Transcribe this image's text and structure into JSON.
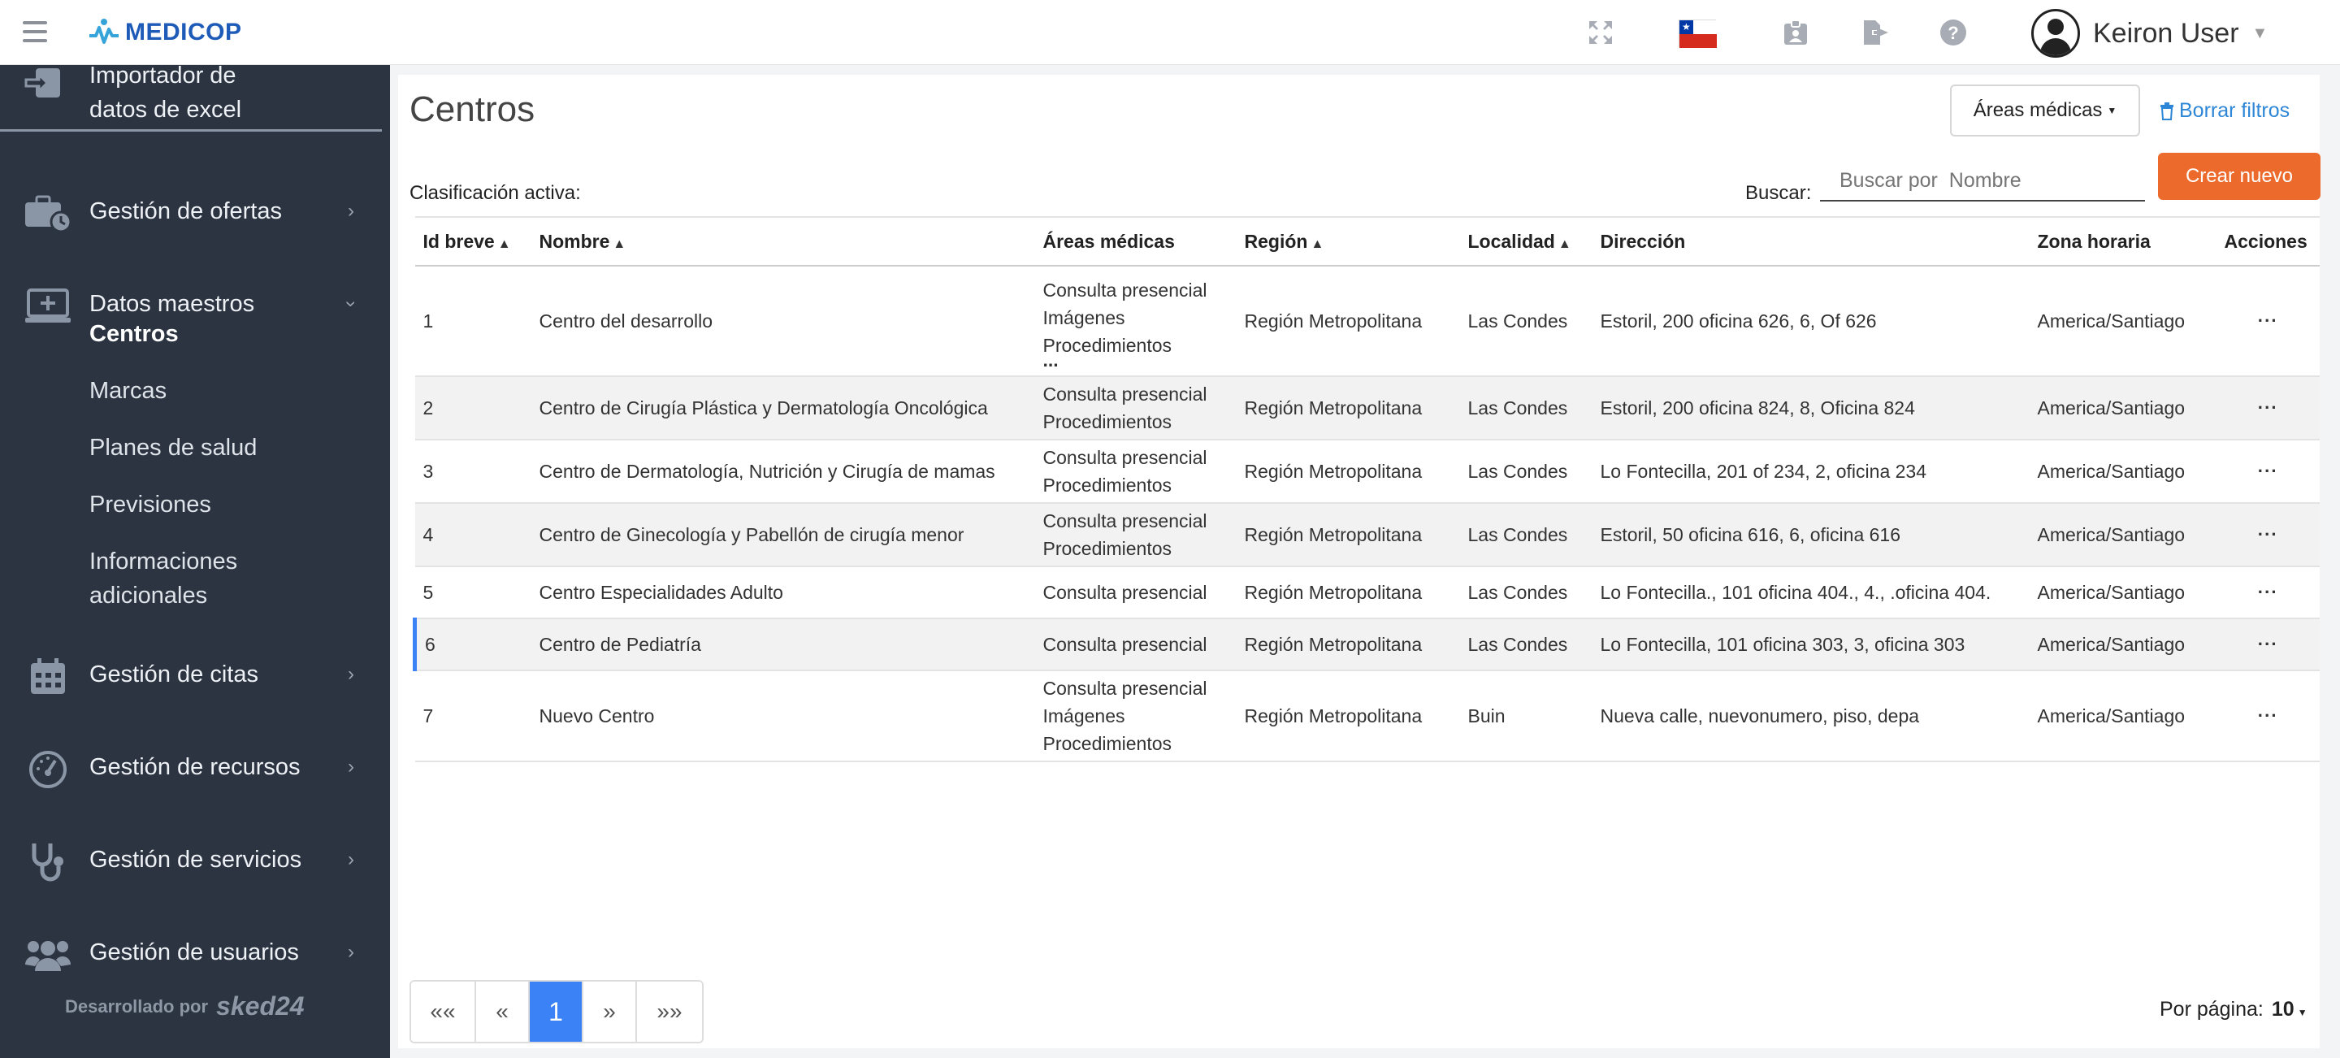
{
  "header": {
    "app_name": "MEDICOP",
    "user_name": "Keiron User",
    "flag": "chile-flag-icon"
  },
  "sidebar": {
    "import_label_1": "Importador de",
    "import_label_2": "datos de excel",
    "items": [
      {
        "label": "Gestión de ofertas",
        "icon": "briefcase-clock-icon"
      },
      {
        "label": "Datos maestros",
        "icon": "monitor-plus-icon"
      },
      {
        "label": "Gestión de citas",
        "icon": "calendar-icon"
      },
      {
        "label": "Gestión de recursos",
        "icon": "gauge-icon"
      },
      {
        "label": "Gestión de servicios",
        "icon": "stethoscope-icon"
      },
      {
        "label": "Gestión de usuarios",
        "icon": "users-icon"
      }
    ],
    "sub_items": [
      "Centros",
      "Marcas",
      "Planes de salud",
      "Previsiones",
      "Informaciones",
      "adicionales"
    ],
    "footer_dev": "Desarrollado por",
    "footer_brand": "sked24"
  },
  "main": {
    "title": "Centros",
    "areas_button": "Áreas médicas",
    "clear_filters": "Borrar filtros",
    "active_class": "Clasificación activa:",
    "search_label": "Buscar:",
    "search_placeholder": "Buscar por  Nombre",
    "create_button": "Crear nuevo",
    "columns": [
      "Id breve",
      "Nombre",
      "Áreas médicas",
      "Región",
      "Localidad",
      "Dirección",
      "Zona horaria",
      "Acciones"
    ],
    "rows": [
      {
        "id": "1",
        "name": "Centro del desarrollo",
        "areas": [
          "Consulta presencial",
          "Imágenes",
          "Procedimientos",
          "..."
        ],
        "region": "Región Metropolitana",
        "loc": "Las Condes",
        "dir": "Estoril, 200 oficina 626, 6, Of 626",
        "tz": "America/Santiago"
      },
      {
        "id": "2",
        "name": "Centro de Cirugía Plástica y Dermatología Oncológica",
        "areas": [
          "Consulta presencial",
          "Procedimientos"
        ],
        "region": "Región Metropolitana",
        "loc": "Las Condes",
        "dir": "Estoril, 200 oficina 824, 8, Oficina 824",
        "tz": "America/Santiago"
      },
      {
        "id": "3",
        "name": "Centro de Dermatología, Nutrición y Cirugía de mamas",
        "areas": [
          "Consulta presencial",
          "Procedimientos"
        ],
        "region": "Región Metropolitana",
        "loc": "Las Condes",
        "dir": "Lo Fontecilla, 201 of 234, 2, oficina 234",
        "tz": "America/Santiago"
      },
      {
        "id": "4",
        "name": "Centro de Ginecología y Pabellón de cirugía menor",
        "areas": [
          "Consulta presencial",
          "Procedimientos"
        ],
        "region": "Región Metropolitana",
        "loc": "Las Condes",
        "dir": "Estoril, 50 oficina 616, 6, oficina 616",
        "tz": "America/Santiago"
      },
      {
        "id": "5",
        "name": "Centro Especialidades Adulto",
        "areas": [
          "Consulta presencial"
        ],
        "region": "Región Metropolitana",
        "loc": "Las Condes",
        "dir": "Lo Fontecilla., 101 oficina 404., 4., .oficina 404.",
        "tz": "America/Santiago"
      },
      {
        "id": "6",
        "name": "Centro de Pediatría",
        "areas": [
          "Consulta presencial"
        ],
        "region": "Región Metropolitana",
        "loc": "Las Condes",
        "dir": "Lo Fontecilla, 101 oficina 303, 3, oficina 303",
        "tz": "America/Santiago"
      },
      {
        "id": "7",
        "name": "Nuevo Centro",
        "areas": [
          "Consulta presencial",
          "Imágenes",
          "Procedimientos"
        ],
        "region": "Región Metropolitana",
        "loc": "Buin",
        "dir": "Nueva calle, nuevonumero, piso, depa",
        "tz": "America/Santiago"
      }
    ],
    "actions_label": "···",
    "pager": {
      "first": "««",
      "prev": "«",
      "current": "1",
      "next": "»",
      "last": "»»"
    },
    "per_page_label": "Por página:",
    "per_page_value": "10"
  },
  "colors": {
    "accent": "#ec6a2b",
    "sidebar": "#2b3440",
    "primary": "#3b82f6",
    "link": "#2e86d6"
  }
}
